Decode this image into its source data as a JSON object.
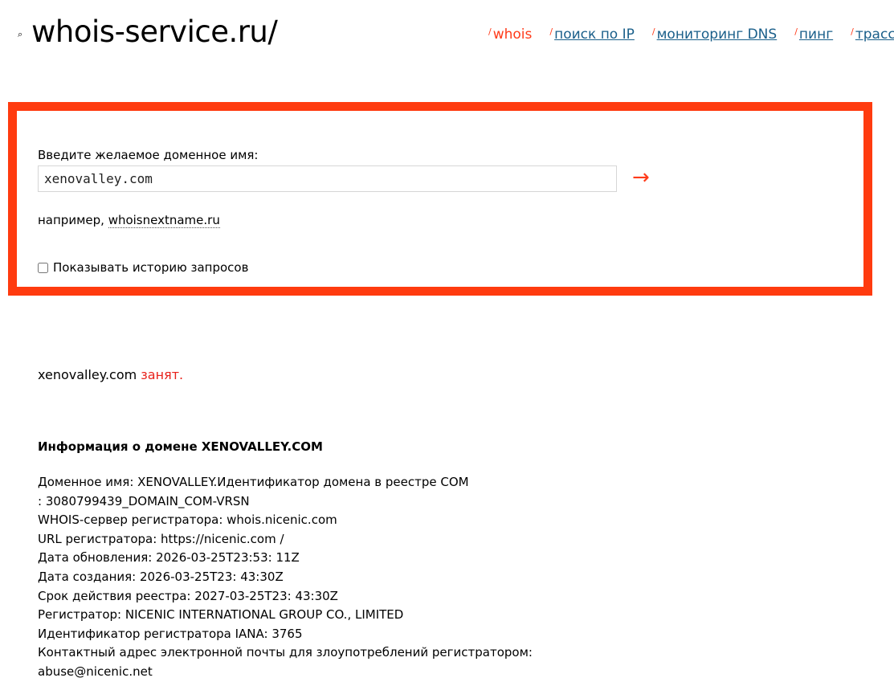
{
  "header": {
    "logo_icon": "⌕",
    "logo_text": "whois-service.ru/"
  },
  "nav": [
    {
      "label": "whois",
      "active": true
    },
    {
      "label": "поиск по IP",
      "active": false
    },
    {
      "label": "мониторинг DNS",
      "active": false
    },
    {
      "label": "пинг",
      "active": false
    },
    {
      "label": "трасс",
      "active": false
    }
  ],
  "search": {
    "prompt": "Введите желаемое доменное имя:",
    "value": "xenovalley.com",
    "submit_icon": "→",
    "example_prefix": "например, ",
    "example_link": "whoisnextname.ru",
    "history_label": "Показывать историю запросов"
  },
  "status": {
    "domain": "xenovalley.com",
    "state": "занят."
  },
  "info": {
    "title": "Информация о домене XENOVALLEY.COM",
    "lines": [
      "Доменное имя: XENOVALLEY.Идентификатор домена в реестре COM",
      ": 3080799439_DOMAIN_COM-VRSN",
      "WHOIS-сервер регистратора: whois.nicenic.com",
      "URL регистратора: https://nicenic.com /",
      "Дата обновления: 2026-03-25T23:53: 11Z",
      "Дата создания: 2026-03-25T23: 43:30Z",
      "Срок действия реестра: 2027-03-25T23: 43:30Z",
      "Регистратор: NICENIC INTERNATIONAL GROUP CO., LIMITED",
      "Идентификатор регистратора IANA: 3765",
      "Контактный адрес электронной почты для злоупотреблений регистратором:",
      "abuse@nicenic.net"
    ]
  },
  "colors": {
    "accent": "#ff3b0f",
    "link": "#1a5f8a",
    "busy": "#e8201a"
  }
}
